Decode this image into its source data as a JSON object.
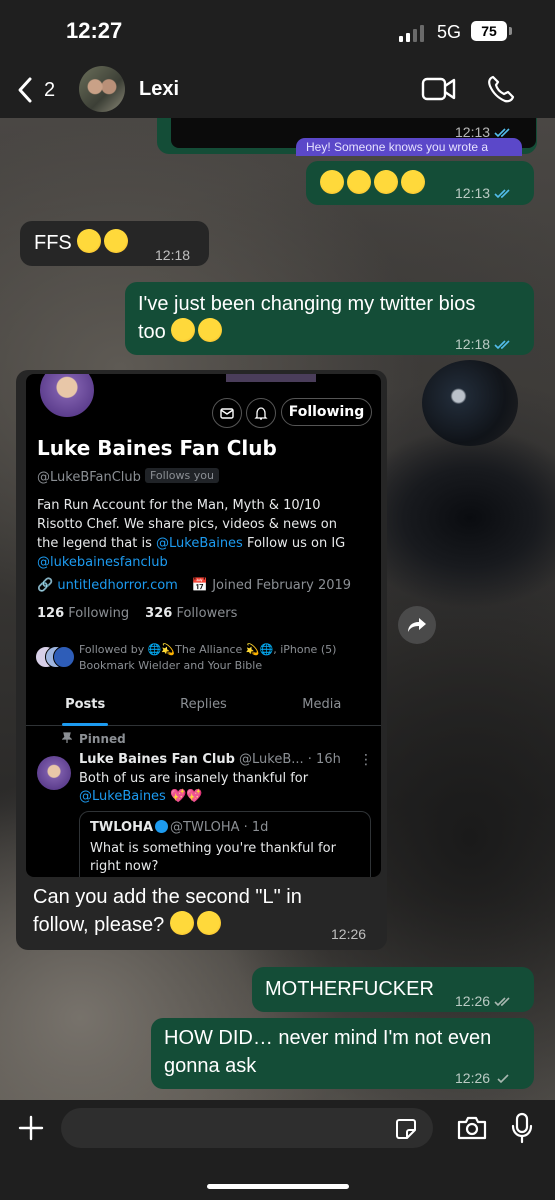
{
  "status_bar": {
    "time": "12:27",
    "network": "5G",
    "battery": "75"
  },
  "header": {
    "back_count": "2",
    "contact_name": "Lexi"
  },
  "messages": [
    {
      "id": "top-partial",
      "direction": "out",
      "preview_snippet": "Hey! Someone knows you wrote a",
      "time": "12:13"
    },
    {
      "id": "emoji-laugh",
      "direction": "out",
      "text": "",
      "time": "12:13"
    },
    {
      "id": "ffs",
      "direction": "in",
      "text": "FFS",
      "time": "12:18"
    },
    {
      "id": "bios",
      "direction": "out",
      "text_line1": "I've just been changing my twitter bios",
      "text_line2": "too",
      "time": "12:18"
    },
    {
      "id": "screenshot",
      "direction": "in",
      "caption_line1": "Can you add the second \"L\" in",
      "caption_line2": "follow, please?",
      "time": "12:26"
    },
    {
      "id": "mf",
      "direction": "out",
      "text": "MOTHERFUCKER",
      "time": "12:26"
    },
    {
      "id": "howdid",
      "direction": "out",
      "text_line1": "HOW DID… never mind I'm not even",
      "text_line2": "gonna ask",
      "time": "12:26"
    }
  ],
  "twitter_profile": {
    "following_button": "Following",
    "name": "Luke Baines Fan Club",
    "handle": "@LukeBFanClub",
    "follows_you": "Follows you",
    "bio_line1": "Fan Run Account for the Man, Myth & 10/10",
    "bio_line2": "Risotto Chef. We share pics, videos & news on",
    "bio_line3_pre": "the legend that is ",
    "bio_mention1": "@LukeBaines",
    "bio_line3_post": " Follow us on IG",
    "bio_mention2": "@lukebainesfanclub",
    "website": "untitledhorror.com",
    "joined": "Joined February 2019",
    "following_count": "126",
    "following_label": "Following",
    "followers_count": "326",
    "followers_label": "Followers",
    "followed_by_line1": "Followed by 🌐💫The Alliance 💫🌐, iPhone (5)",
    "followed_by_line2": "Bookmark Wielder and Your Bible",
    "tabs": [
      "Posts",
      "Replies",
      "Media"
    ],
    "pinned_label": "Pinned",
    "post_name": "Luke Baines Fan Club",
    "post_handle_time": "@LukeB... · 16h",
    "post_text": "Both of us are insanely thankful for",
    "post_mention": "@LukeBaines",
    "quote_name": "TWLOHA",
    "quote_handle_time": "@TWLOHA · 1d",
    "quote_text": "What is something you're thankful for right now?"
  },
  "input": {
    "placeholder": ""
  },
  "colors": {
    "outgoing_bubble": "#144d37",
    "incoming_bubble": "#262626",
    "tick_read": "#53bdeb",
    "twitter_link": "#1d9bf0"
  }
}
